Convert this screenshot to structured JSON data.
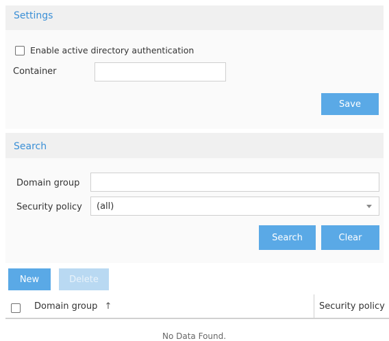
{
  "settings": {
    "title": "Settings",
    "enable_ad_label": "Enable active directory authentication",
    "enable_ad_checked": false,
    "container_label": "Container",
    "container_value": "",
    "save_label": "Save"
  },
  "search": {
    "title": "Search",
    "domain_group_label": "Domain group",
    "domain_group_value": "",
    "security_policy_label": "Security policy",
    "security_policy_value": "(all)",
    "search_label": "Search",
    "clear_label": "Clear"
  },
  "toolbar": {
    "new_label": "New",
    "delete_label": "Delete"
  },
  "grid": {
    "columns": [
      {
        "label": "Domain group",
        "sort_icon": "sort-ascending-arrow",
        "sort_glyph": "↑"
      },
      {
        "label": "Security policy"
      }
    ],
    "empty_text": "No Data Found."
  },
  "colors": {
    "accent": "#3a8fd6",
    "button": "#5aa9e6",
    "button_disabled": "#b9d9f2"
  }
}
